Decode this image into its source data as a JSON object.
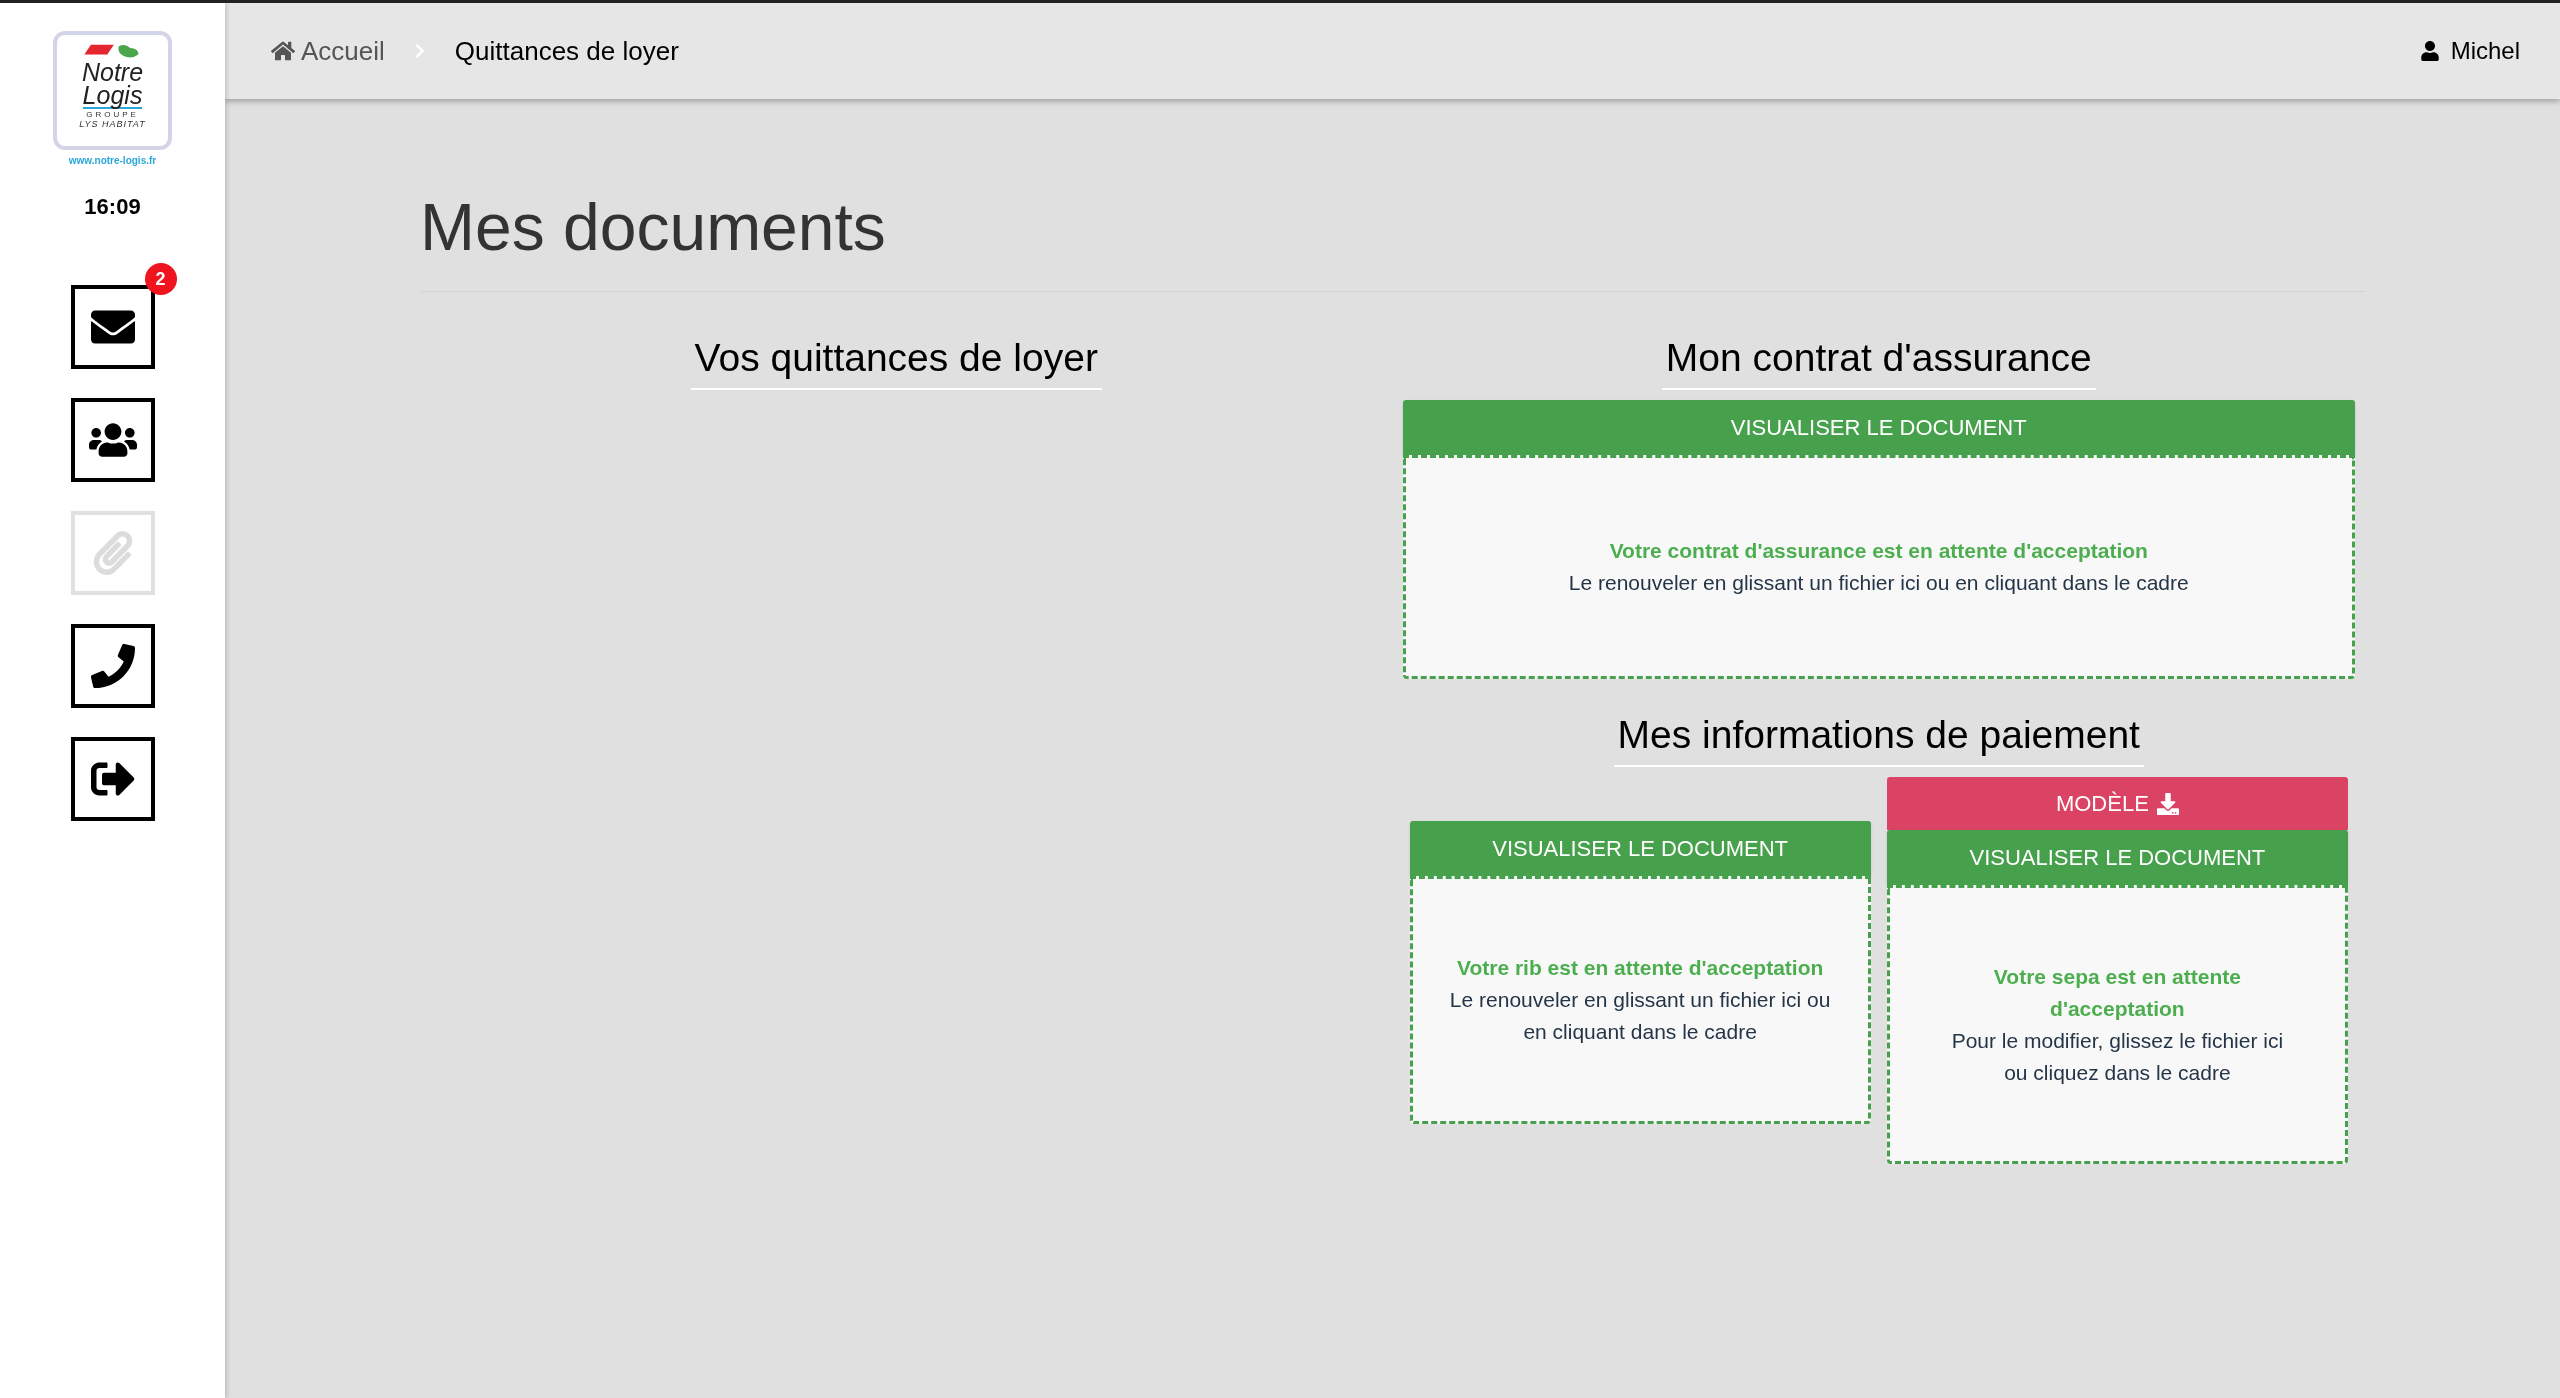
{
  "sidebar": {
    "logo": {
      "line_1": "Notre",
      "line_2": "Logis",
      "line_3": "GROUPE",
      "line_4": "LYS HABITAT"
    },
    "website": "www.notre-logis.fr",
    "time": "16:09",
    "nav_items": [
      {
        "badge": "2",
        "disabled": false
      },
      {
        "disabled": false
      },
      {
        "disabled": true
      },
      {
        "disabled": false
      },
      {
        "disabled": false
      }
    ]
  },
  "breadcrumb": [
    {
      "label": "Accueil",
      "selected": false
    },
    {
      "label": "Quittances de loyer",
      "selected": true
    }
  ],
  "user": "Michel",
  "page_title": "Mes documents",
  "left_section": {
    "title": "Vos quittances de loyer"
  },
  "insurance_section": {
    "title": "Mon contrat d'assurance",
    "cards": [
      {
        "button": "VISUALISER LE DOCUMENT",
        "status": "Votre contrat d'assurance est en attente d'acceptation",
        "hint": "Le renouveler en glissant un fichier ici ou en cliquant dans le cadre"
      }
    ]
  },
  "payment_section": {
    "title": "Mes informations de paiement",
    "cards": [
      {
        "button": "VISUALISER LE DOCUMENT",
        "status": "Votre rib est en attente d'acceptation",
        "hint": "Le renouveler en glissant un fichier ici ou en cliquant dans le cadre"
      },
      {
        "template_button": "MODÈLE",
        "button": "VISUALISER LE DOCUMENT",
        "status": "Votre sepa est en attente d'acceptation",
        "hint": "Pour le modifier, glissez le fichier ici ou cliquez dans le cadre"
      }
    ]
  }
}
